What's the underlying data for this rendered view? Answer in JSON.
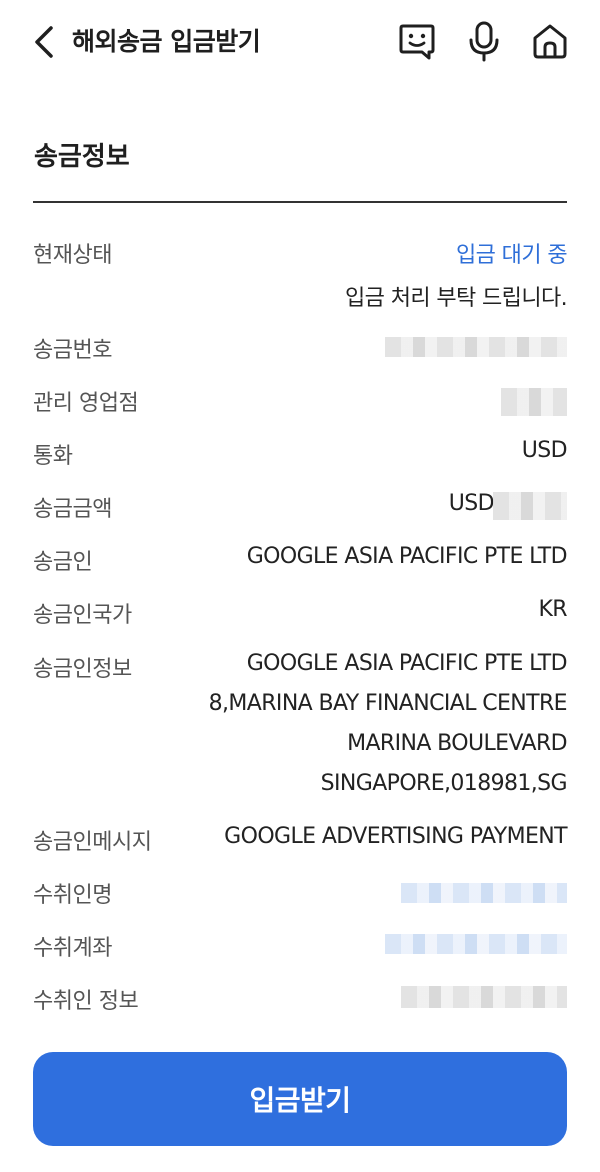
{
  "header": {
    "title": "해외송금 입금받기",
    "icons": {
      "back": "chevron-left-icon",
      "chat": "chatbot-icon",
      "mic": "microphone-icon",
      "home": "home-icon"
    }
  },
  "section": {
    "title": "송금정보"
  },
  "fields": {
    "status": {
      "label": "현재상태",
      "value": "입금 대기 중",
      "note": "입금 처리 부탁 드립니다."
    },
    "remittance_no": {
      "label": "송금번호"
    },
    "branch": {
      "label": "관리 영업점"
    },
    "currency": {
      "label": "통화",
      "value": "USD"
    },
    "amount": {
      "label": "송금금액",
      "value": "USD"
    },
    "sender": {
      "label": "송금인",
      "value": "GOOGLE ASIA PACIFIC PTE LTD"
    },
    "sender_country": {
      "label": "송금인국가",
      "value": "KR"
    },
    "sender_info": {
      "label": "송금인정보",
      "lines": [
        "GOOGLE ASIA PACIFIC PTE LTD",
        "8,MARINA BAY FINANCIAL CENTRE",
        "MARINA BOULEVARD",
        "SINGAPORE,018981,SG"
      ]
    },
    "sender_message": {
      "label": "송금인메시지",
      "value": "GOOGLE ADVERTISING PAYMENT"
    },
    "recipient_name": {
      "label": "수취인명"
    },
    "recipient_account": {
      "label": "수취계좌"
    },
    "recipient_info": {
      "label": "수취인 정보"
    }
  },
  "button": {
    "label": "입금받기"
  },
  "colors": {
    "accent": "#2f6fde",
    "status": "#2f6fd8",
    "text": "#1f1f1f",
    "label": "#555555"
  }
}
